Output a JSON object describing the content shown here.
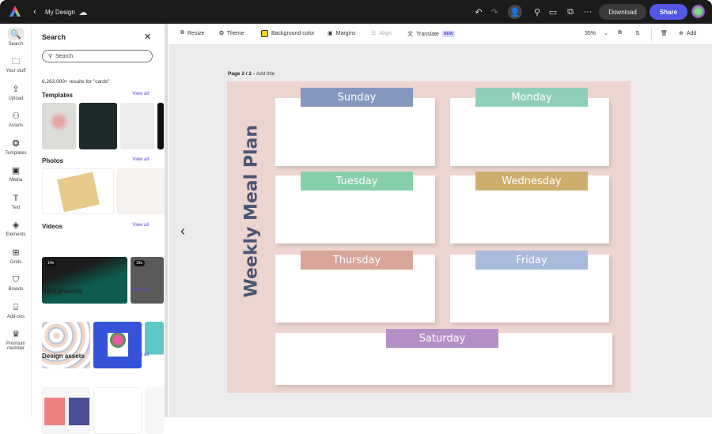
{
  "topbar": {
    "doc_title": "My Design",
    "download": "Download",
    "share": "Share"
  },
  "rail": [
    {
      "label": "Search",
      "icon": "🔍"
    },
    {
      "label": "Your stuff",
      "icon": "🗀"
    },
    {
      "label": "Upload",
      "icon": "⇪"
    },
    {
      "label": "Assets",
      "icon": "⚇"
    },
    {
      "label": "Templates",
      "icon": "❂"
    },
    {
      "label": "Media",
      "icon": "▣"
    },
    {
      "label": "Text",
      "icon": "T"
    },
    {
      "label": "Elements",
      "icon": "◈"
    },
    {
      "label": "Grids",
      "icon": "⊞"
    },
    {
      "label": "Brands",
      "icon": "⛉"
    },
    {
      "label": "Add-ons",
      "icon": "⌸"
    },
    {
      "label": "Premium member",
      "icon": "♛"
    }
  ],
  "panel": {
    "title": "Search",
    "placeholder": "Search",
    "results": "6,263,000+ results for \"cards\"",
    "view_all": "View all",
    "sections": [
      "Templates",
      "Photos",
      "Videos",
      "Backgrounds",
      "Design assets"
    ],
    "video_durations": [
      "14s",
      "19s"
    ]
  },
  "toolbar": {
    "resize": "Resize",
    "theme": "Theme",
    "bg": "Background color",
    "margins": "Margins",
    "align": "Align",
    "translate": "Translate",
    "new": "NEW",
    "zoom": "35%",
    "add": "Add"
  },
  "canvas": {
    "page_label": "Page 2 / 2 - ",
    "add_title": "Add title",
    "title": "Weekly Meal Plan",
    "days": [
      {
        "name": "Sunday",
        "color": "#8697bf"
      },
      {
        "name": "Monday",
        "color": "#8fcfba"
      },
      {
        "name": "Tuesday",
        "color": "#87cfa8"
      },
      {
        "name": "Wednesday",
        "color": "#cfad6c"
      },
      {
        "name": "Thursday",
        "color": "#d9a499"
      },
      {
        "name": "Friday",
        "color": "#a9badb"
      },
      {
        "name": "Saturday",
        "color": "#b58fc7"
      }
    ]
  }
}
